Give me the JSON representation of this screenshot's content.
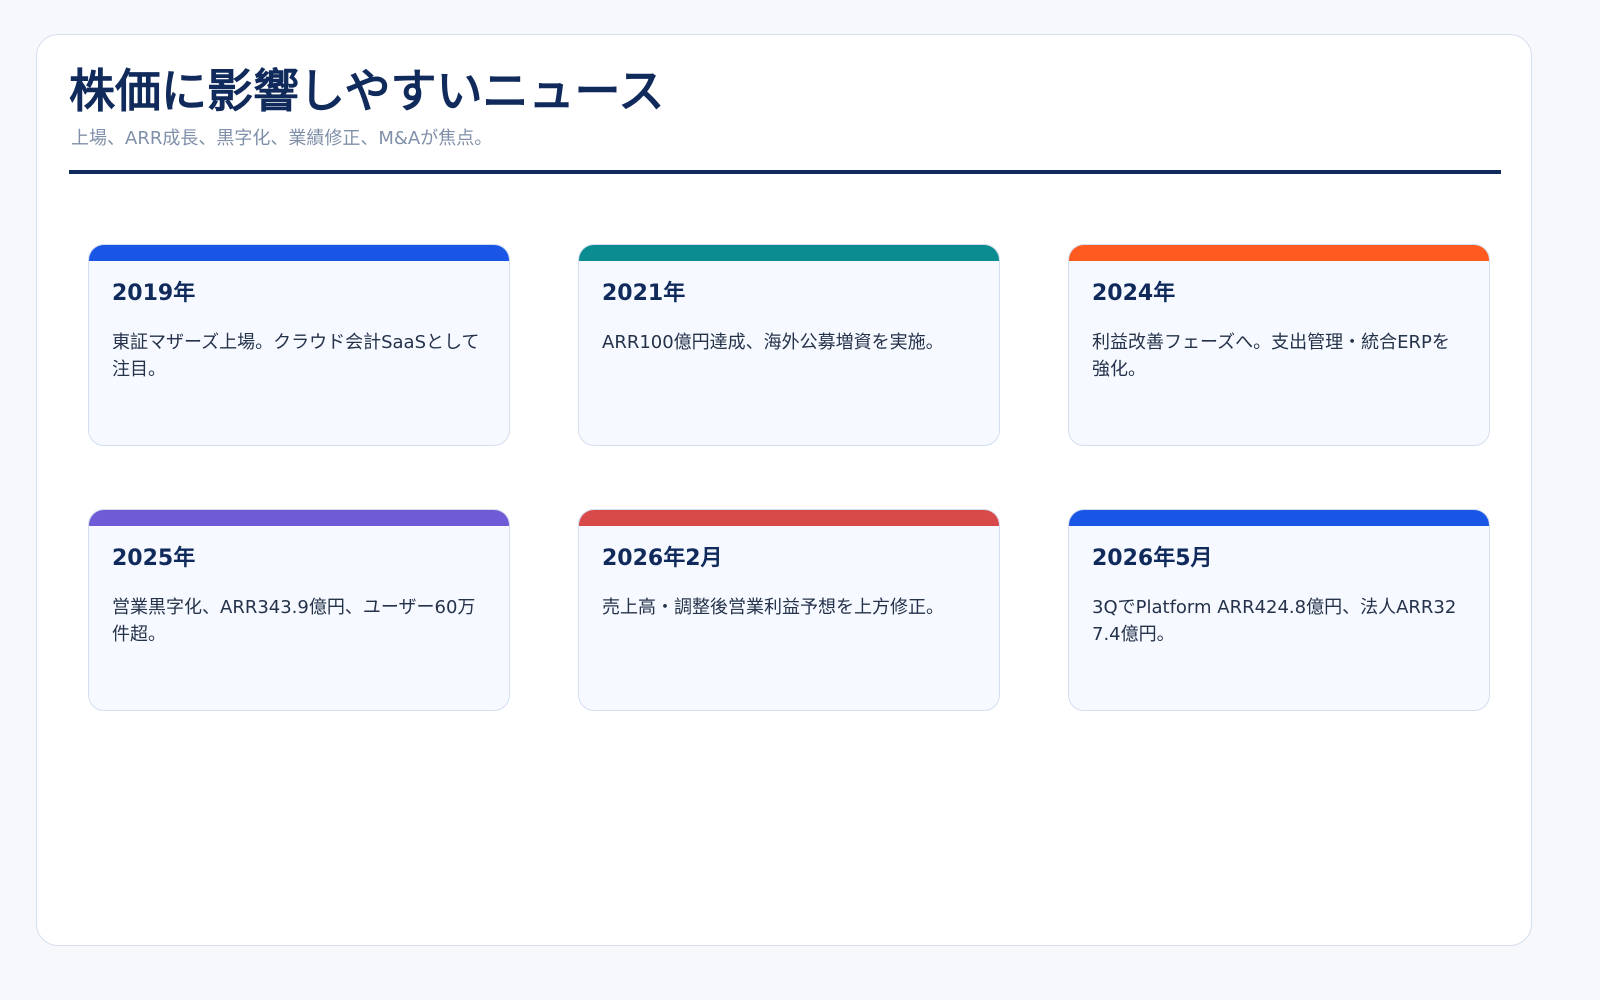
{
  "header": {
    "title": "株価に影響しやすいニュース",
    "subtitle": "上場、ARR成長、黒字化、業績修正、M&Aが焦点。"
  },
  "cards": [
    {
      "heading": "2019年",
      "text": "東証マザーズ上場。クラウド会計SaaSとして注目。",
      "accent": "#1a56e6"
    },
    {
      "heading": "2021年",
      "text": "ARR100億円達成、海外公募増資を実施。",
      "accent": "#0a8c91"
    },
    {
      "heading": "2024年",
      "text": "利益改善フェーズへ。支出管理・統合ERPを強化。",
      "accent": "#ff5a1f"
    },
    {
      "heading": "2025年",
      "text": "営業黒字化、ARR343.9億円、ユーザー60万件超。",
      "accent": "#6f5bd6"
    },
    {
      "heading": "2026年2月",
      "text": "売上高・調整後営業利益予想を上方修正。",
      "accent": "#d84a4a"
    },
    {
      "heading": "2026年5月",
      "text": "3QでPlatform ARR424.8億円、法人ARR327.4億円。",
      "accent": "#1a56e6"
    }
  ]
}
